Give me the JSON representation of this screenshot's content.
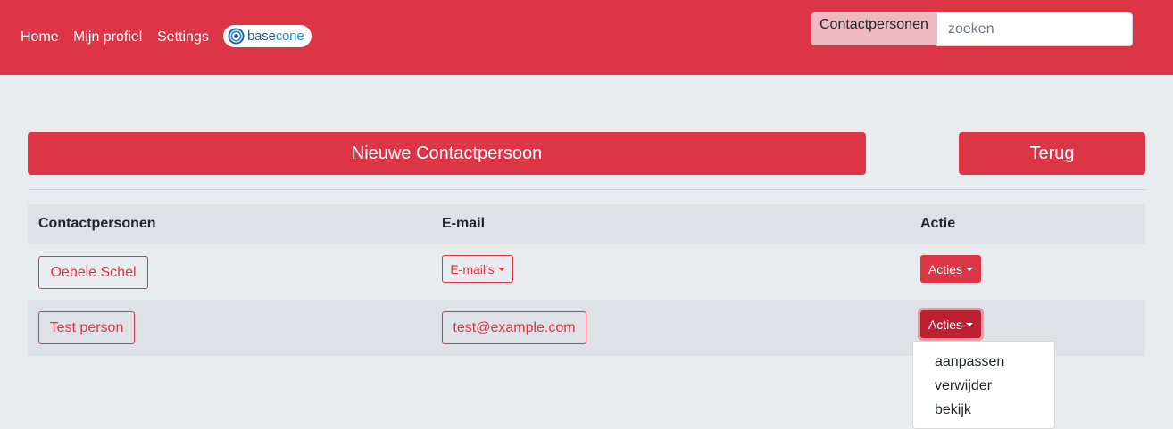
{
  "nav": {
    "links": [
      "Home",
      "Mijn profiel",
      "Settings"
    ],
    "logo_part1": "base",
    "logo_part2": "cone",
    "search_label": "Contactpersonen",
    "search_placeholder": "zoeken"
  },
  "actions": {
    "new_contact": "Nieuwe Contactpersoon",
    "back": "Terug"
  },
  "table": {
    "headers": [
      "Contactpersonen",
      "E-mail",
      "Actie"
    ],
    "rows": [
      {
        "name": "Oebele Schel",
        "email": "E-mail's",
        "action": "Acties"
      },
      {
        "name": "Test person",
        "email": "test@example.com",
        "action": "Acties"
      }
    ]
  },
  "dropdown": {
    "items": [
      "aanpassen",
      "verwijder",
      "bekijk"
    ]
  },
  "colors": {
    "primary": "#dc3545",
    "background": "#e9ecef",
    "table_header": "#dee2e6"
  }
}
